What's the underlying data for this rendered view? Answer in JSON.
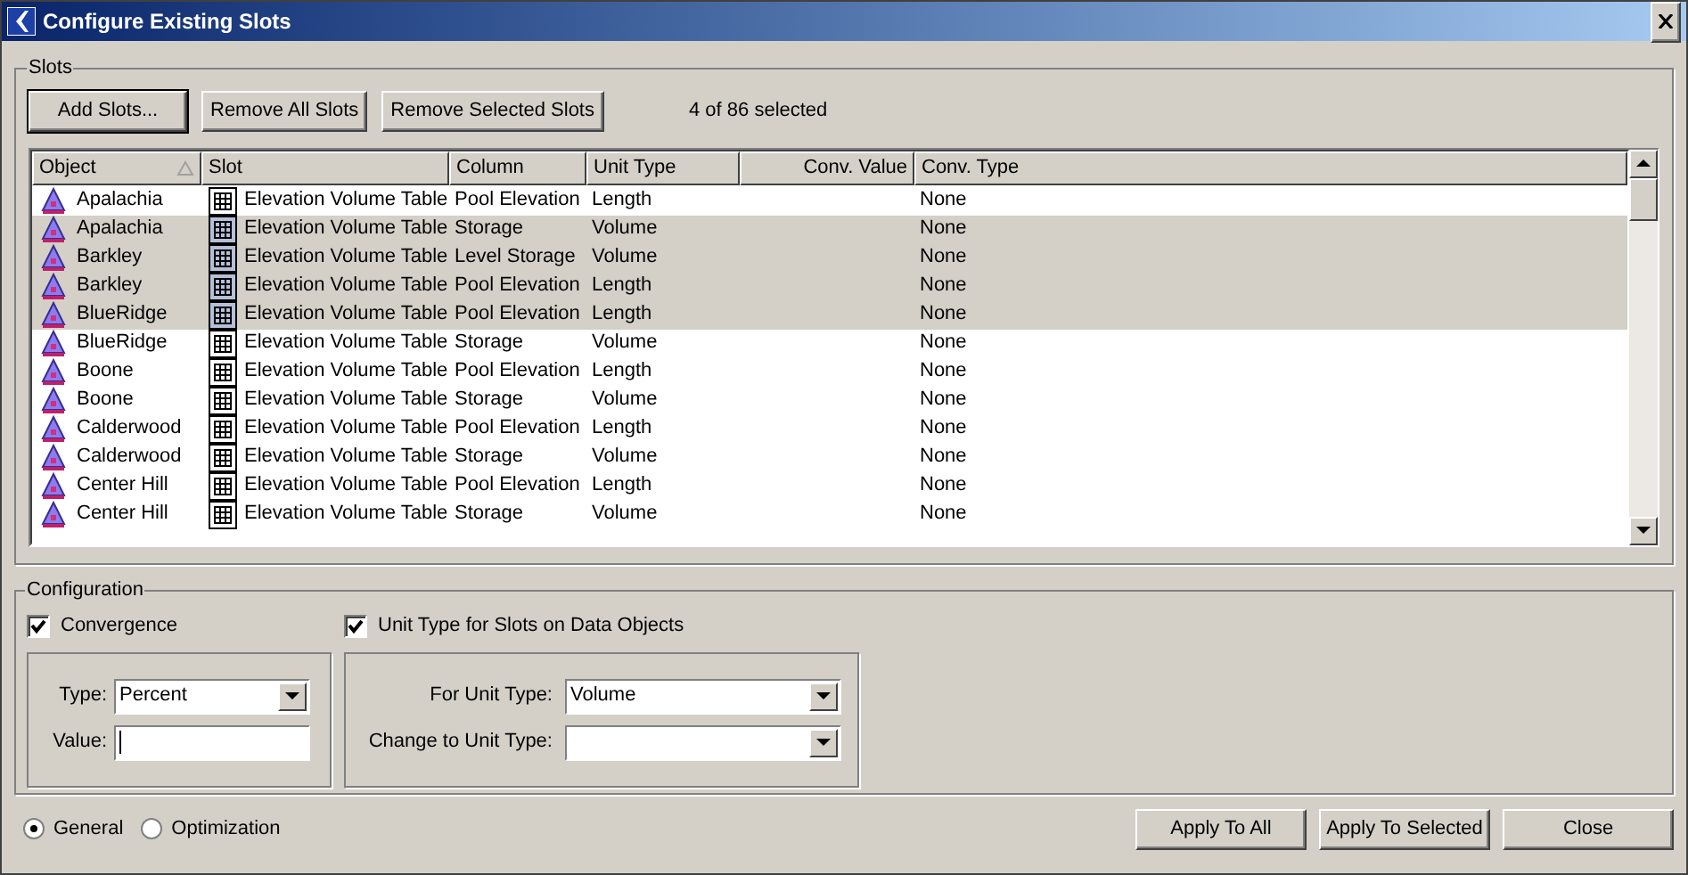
{
  "window": {
    "title": "Configure Existing Slots"
  },
  "slots": {
    "legend": "Slots",
    "buttons": [
      "Add Slots...",
      "Remove All Slots",
      "Remove Selected Slots"
    ],
    "selection_count": "4 of 86 selected",
    "table": {
      "columns": [
        "Object",
        "Slot",
        "Column",
        "Unit Type",
        "Conv. Value",
        "Conv. Type"
      ],
      "rows": [
        {
          "object": "Apalachia",
          "slot": "Elevation Volume Table",
          "column": "Pool Elevation",
          "unit_type": "Length",
          "conv_type": "None",
          "selected": false
        },
        {
          "object": "Apalachia",
          "slot": "Elevation Volume Table",
          "column": "Storage",
          "unit_type": "Volume",
          "conv_type": "None",
          "selected": true
        },
        {
          "object": "Barkley",
          "slot": "Elevation Volume Table",
          "column": "Level Storage",
          "unit_type": "Volume",
          "conv_type": "None",
          "selected": true
        },
        {
          "object": "Barkley",
          "slot": "Elevation Volume Table",
          "column": "Pool Elevation",
          "unit_type": "Length",
          "conv_type": "None",
          "selected": true
        },
        {
          "object": "BlueRidge",
          "slot": "Elevation Volume Table",
          "column": "Pool Elevation",
          "unit_type": "Length",
          "conv_type": "None",
          "selected": true
        },
        {
          "object": "BlueRidge",
          "slot": "Elevation Volume Table",
          "column": "Storage",
          "unit_type": "Volume",
          "conv_type": "None",
          "selected": false
        },
        {
          "object": "Boone",
          "slot": "Elevation Volume Table",
          "column": "Pool Elevation",
          "unit_type": "Length",
          "conv_type": "None",
          "selected": false
        },
        {
          "object": "Boone",
          "slot": "Elevation Volume Table",
          "column": "Storage",
          "unit_type": "Volume",
          "conv_type": "None",
          "selected": false
        },
        {
          "object": "Calderwood",
          "slot": "Elevation Volume Table",
          "column": "Pool Elevation",
          "unit_type": "Length",
          "conv_type": "None",
          "selected": false
        },
        {
          "object": "Calderwood",
          "slot": "Elevation Volume Table",
          "column": "Storage",
          "unit_type": "Volume",
          "conv_type": "None",
          "selected": false
        },
        {
          "object": "Center Hill",
          "slot": "Elevation Volume Table",
          "column": "Pool Elevation",
          "unit_type": "Length",
          "conv_type": "None",
          "selected": false
        },
        {
          "object": "Center Hill",
          "slot": "Elevation Volume Table",
          "column": "Storage",
          "unit_type": "Volume",
          "conv_type": "None",
          "selected": false
        }
      ]
    }
  },
  "configuration": {
    "legend": "Configuration",
    "convergence": {
      "label": "Convergence",
      "checked": true,
      "type_label": "Type:",
      "type_value": "Percent",
      "value_label": "Value:"
    },
    "unit_type": {
      "label": "Unit Type for Slots on Data Objects",
      "checked": true,
      "for_label": "For Unit Type:",
      "for_value": "Volume",
      "change_label": "Change to Unit Type:"
    }
  },
  "modes": [
    {
      "label": "General",
      "selected": true
    },
    {
      "label": "Optimization",
      "selected": false
    }
  ],
  "buttons": [
    "Apply To All",
    "Apply To Selected",
    "Close"
  ]
}
